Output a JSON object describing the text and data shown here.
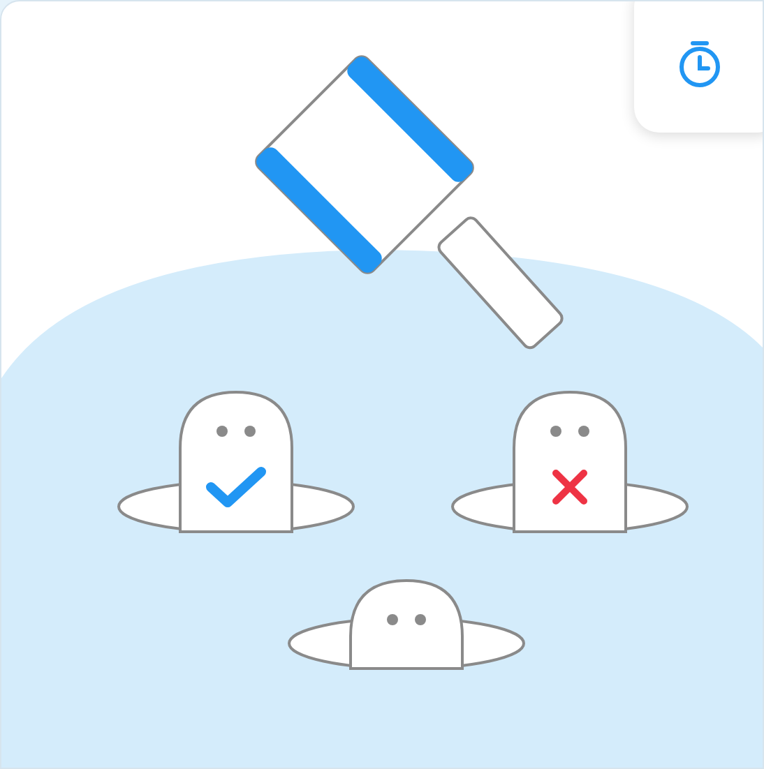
{
  "timer_button": {
    "kind": "timer"
  },
  "moles": [
    {
      "kind": "correct"
    },
    {
      "kind": "wrong"
    },
    {
      "kind": "neutral"
    }
  ]
}
